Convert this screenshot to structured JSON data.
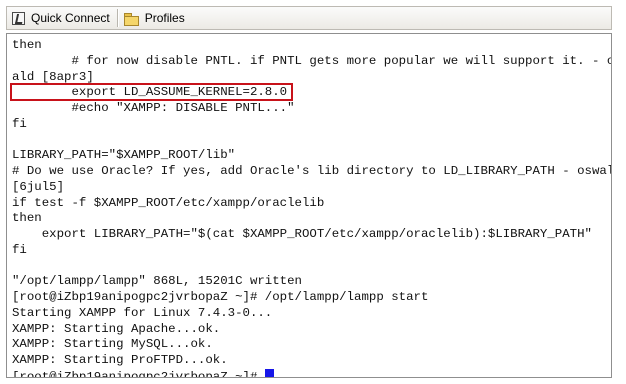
{
  "toolbar": {
    "quick_connect_label": "Quick Connect",
    "profiles_label": "Profiles",
    "icons": [
      "quick-connect-icon",
      "folder-icon"
    ]
  },
  "terminal": {
    "lines": [
      "then",
      "        # for now disable PNTL. if PNTL gets more popular we will support it. - osw",
      "ald [8apr3]",
      "        export LD_ASSUME_KERNEL=2.8.0",
      "        #echo \"XAMPP: DISABLE PNTL...\"",
      "fi",
      "",
      "LIBRARY_PATH=\"$XAMPP_ROOT/lib\"",
      "# Do we use Oracle? If yes, add Oracle's lib directory to LD_LIBRARY_PATH - oswald",
      "[6jul5]",
      "if test -f $XAMPP_ROOT/etc/xampp/oraclelib",
      "then",
      "    export LIBRARY_PATH=\"$(cat $XAMPP_ROOT/etc/xampp/oraclelib):$LIBRARY_PATH\"",
      "fi",
      "",
      "\"/opt/lampp/lampp\" 868L, 15201C written",
      "[root@iZbp19anipogpc2jvrbopaZ ~]# /opt/lampp/lampp start",
      "Starting XAMPP for Linux 7.4.3-0...",
      "XAMPP: Starting Apache...ok.",
      "XAMPP: Starting MySQL...ok.",
      "XAMPP: Starting ProFTPD...ok."
    ],
    "prompt": "[root@iZbp19anipogpc2jvrbopaZ ~]# ",
    "highlight_color": "#c8121a",
    "cursor_color": "#1616e8"
  }
}
